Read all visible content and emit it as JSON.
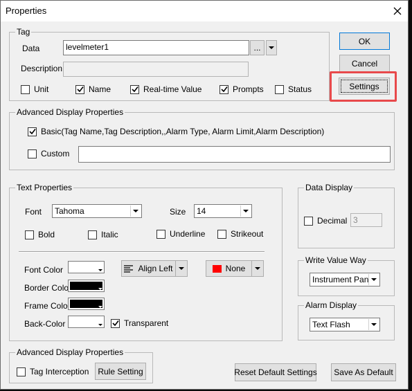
{
  "window": {
    "title": "Properties"
  },
  "tag": {
    "group_label": "Tag",
    "data_label": "Data",
    "data_value": "levelmeter1",
    "browse_label": "...",
    "description_label": "Description",
    "description_value": "",
    "checkboxes": [
      {
        "label": "Unit",
        "checked": false
      },
      {
        "label": "Name",
        "checked": true
      },
      {
        "label": "Real-time Value",
        "checked": true
      },
      {
        "label": "Prompts",
        "checked": true
      },
      {
        "label": "Status",
        "checked": false
      }
    ]
  },
  "buttons": {
    "ok": "OK",
    "cancel": "Cancel",
    "settings": "Settings",
    "reset_default": "Reset Default Settings",
    "save_default": "Save As Default",
    "rule_setting": "Rule Setting"
  },
  "advanced_display": {
    "group_label": "Advanced Display Properties",
    "basic_label": "Basic(Tag Name,Tag Description,,Alarm Type, Alarm Limit,Alarm Description)",
    "basic_checked": true,
    "custom_label": "Custom",
    "custom_checked": false,
    "custom_value": ""
  },
  "text_properties": {
    "group_label": "Text Properties",
    "font_label": "Font",
    "font_value": "Tahoma",
    "size_label": "Size",
    "size_value": "14",
    "bold_label": "Bold",
    "italic_label": "Italic",
    "underline_label": "Underline",
    "strikeout_label": "Strikeout",
    "font_color_label": "Font Color",
    "border_color_label": "Border Color",
    "frame_color_label": "Frame Color",
    "back_color_label": "Back-Color",
    "transparent_label": "Transparent",
    "transparent_checked": true,
    "align_label": "Align Left",
    "fill_label": "None",
    "colors": {
      "font_color": "#ffffff",
      "border_color": "#000000",
      "frame_color": "#000000",
      "back_color": "#ffffff",
      "fill_swatch": "#ff0000"
    }
  },
  "data_display": {
    "group_label": "Data Display",
    "decimal_label": "Decimal",
    "decimal_checked": false,
    "decimal_value": "3"
  },
  "write_value_way": {
    "group_label": "Write Value Way",
    "value": "Instrument Panel"
  },
  "alarm_display": {
    "group_label": "Alarm Display",
    "value": "Text Flash"
  },
  "advanced_display_2": {
    "group_label": "Advanced Display Properties",
    "tag_interception_label": "Tag Interception",
    "tag_interception_checked": false
  },
  "accent": {
    "highlight": "#e8494b"
  }
}
